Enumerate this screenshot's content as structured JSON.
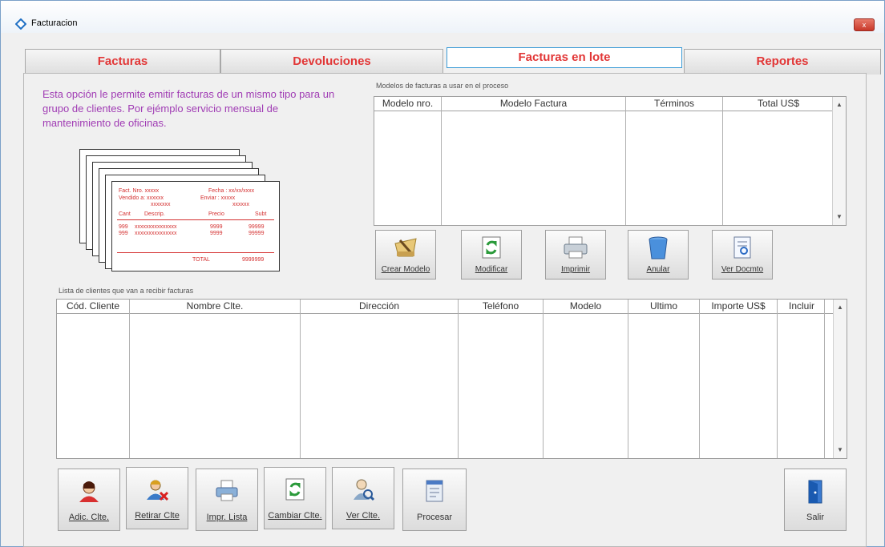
{
  "window": {
    "title": "Facturacion",
    "close_label": "x"
  },
  "tabs": [
    {
      "label": "Facturas"
    },
    {
      "label": "Devoluciones"
    },
    {
      "label": "Facturas en lote"
    },
    {
      "label": "Reportes"
    }
  ],
  "active_tab": "Facturas en lote",
  "intro_text": "Esta opción le permite emitir facturas de un mismo tipo para un grupo de clientes. Por ejémplo servicio mensual de mantenimiento de oficinas.",
  "illustration": {
    "fact_nro": "Fact. Nro.  xxxxx",
    "fecha": "Fecha :  xx/xx/xxxx",
    "vendido": "Vendido a:  xxxxxx",
    "vendido2": "xxxxxxx",
    "enviar": "Enviar :  xxxxx",
    "enviar2": "xxxxxx",
    "col_cant": "Cant",
    "col_descrip": "Descrip.",
    "col_precio": "Precio",
    "col_subt": "Subt",
    "row1_cant": "999",
    "row1_desc": "xxxxxxxxxxxxxxx",
    "row1_precio": "9999",
    "row1_subt": "99999",
    "row2_cant": "999",
    "row2_desc": "xxxxxxxxxxxxxxx",
    "row2_precio": "9999",
    "row2_subt": "99999",
    "total_label": "TOTAL",
    "total_value": "9999999"
  },
  "models": {
    "label": "Modelos de facturas a usar en el proceso",
    "columns": [
      "Modelo nro.",
      "Modelo Factura",
      "Términos",
      "Total US$"
    ],
    "rows": []
  },
  "model_buttons": [
    {
      "label": "Crear Modelo",
      "icon": "create-model-icon"
    },
    {
      "label": "Modificar",
      "icon": "refresh-icon"
    },
    {
      "label": "Imprimir",
      "icon": "print-icon"
    },
    {
      "label": "Anular",
      "icon": "trash-icon"
    },
    {
      "label": "Ver Docmto",
      "icon": "view-document-icon"
    }
  ],
  "clients": {
    "label": "Lista de clientes que van a recibir facturas",
    "columns": [
      "Cód. Cliente",
      "Nombre Clte.",
      "Dirección",
      "Teléfono",
      "Modelo",
      "Ultimo",
      "Importe US$",
      "Incluir"
    ],
    "rows": []
  },
  "client_buttons": [
    {
      "label": "Adic. Clte.",
      "icon": "add-client-icon"
    },
    {
      "label": "Retirar Clte",
      "icon": "remove-client-icon"
    },
    {
      "label": "Impr. Lista",
      "icon": "print-icon"
    },
    {
      "label": "Cambiar Clte.",
      "icon": "refresh-icon"
    },
    {
      "label": "Ver Clte.",
      "icon": "view-client-icon"
    },
    {
      "label": "Procesar",
      "icon": "process-icon"
    }
  ],
  "exit_button": {
    "label": "Salir",
    "icon": "exit-door-icon"
  },
  "colors": {
    "tab_text": "#e23636",
    "intro_text": "#a03cb4",
    "illustration_text": "#d43030"
  }
}
